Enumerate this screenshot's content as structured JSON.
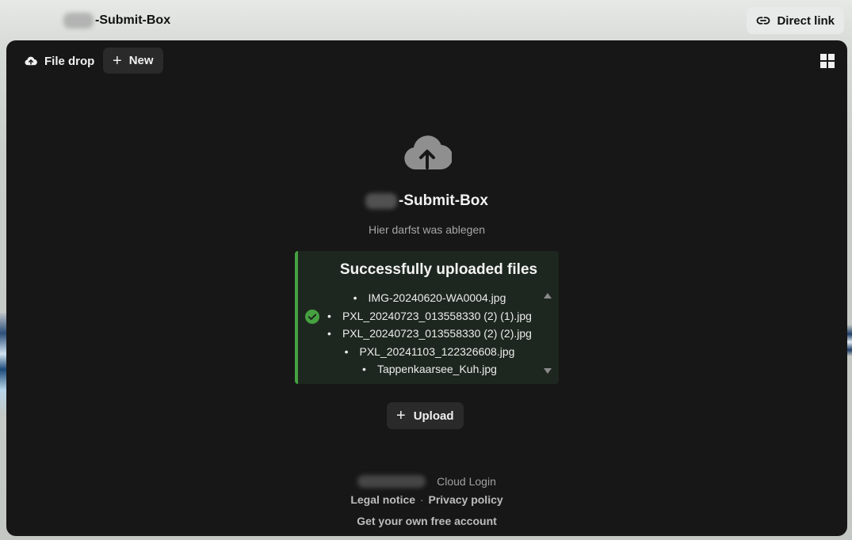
{
  "header": {
    "title": "-Submit-Box",
    "direct_link_label": "Direct link"
  },
  "toolbar": {
    "file_drop_label": "File drop",
    "new_label": "New"
  },
  "main": {
    "title": "-Submit-Box",
    "subtitle": "Hier darfst was ablegen",
    "success_title": "Successfully uploaded files",
    "files": [
      "IMG-20240620-WA0004.jpg",
      "PXL_20240723_013558330 (2) (1).jpg",
      "PXL_20240723_013558330 (2) (2).jpg",
      "PXL_20241103_122326608.jpg",
      "Tappenkaarsee_Kuh.jpg"
    ],
    "upload_label": "Upload"
  },
  "footer": {
    "cloud_login": "Cloud Login",
    "legal_notice": "Legal notice",
    "separator": "·",
    "privacy_policy": "Privacy policy",
    "own_account": "Get your own free account"
  },
  "colors": {
    "panel_bg": "#171717",
    "success_border": "#46a141",
    "success_bg": "#1e271f",
    "check": "#46a141"
  },
  "icons": {
    "direct_link": "link-icon",
    "file_drop": "cloud-upload-icon",
    "new": "plus-icon",
    "view_toggle": "grid-icon",
    "success": "check-circle-icon",
    "upload": "plus-icon"
  }
}
